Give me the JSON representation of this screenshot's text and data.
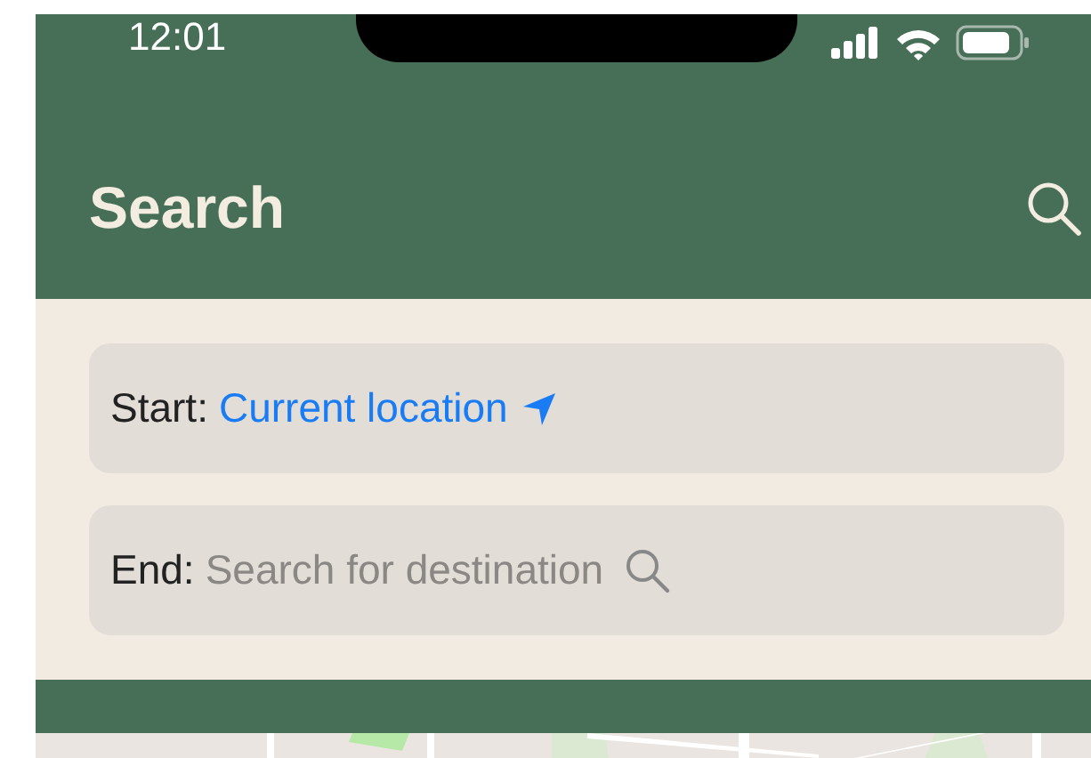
{
  "status_bar": {
    "time": "12:01"
  },
  "header": {
    "title": "Search"
  },
  "route": [
    {
      "kind": "start",
      "label": "Start:",
      "value": "Current location"
    },
    {
      "kind": "end",
      "label": "End:",
      "placeholder": "Search for destination"
    }
  ]
}
